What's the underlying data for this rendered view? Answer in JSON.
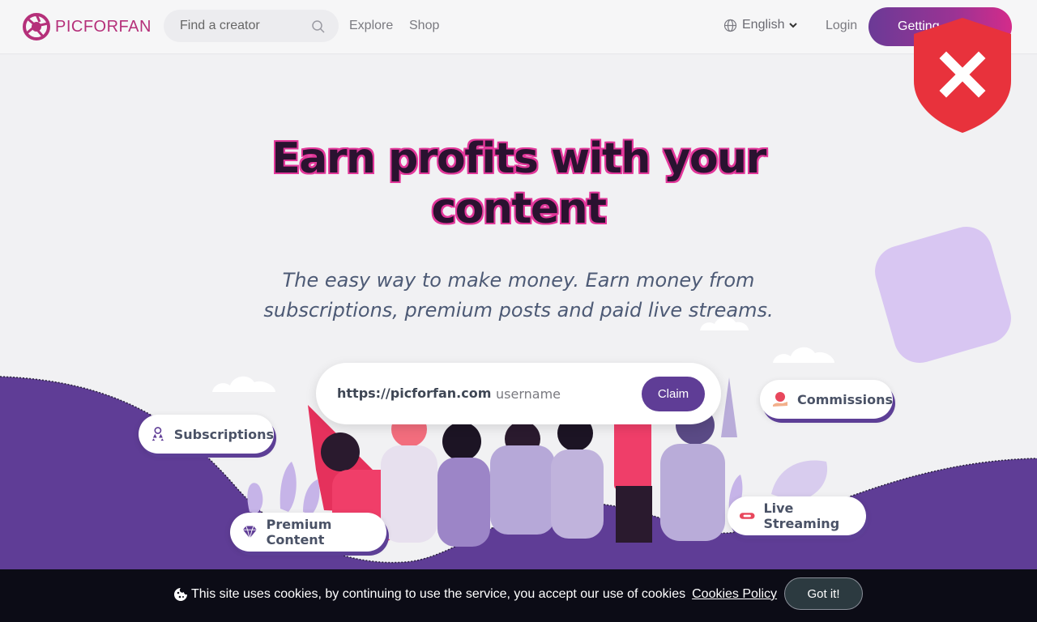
{
  "header": {
    "brand": "PICFORFAN",
    "search_placeholder": "Find a creator",
    "nav": {
      "explore": "Explore",
      "shop": "Shop"
    },
    "language": "English",
    "login": "Login",
    "cta": "Getting"
  },
  "hero": {
    "title_line1": "Earn profits with your",
    "title_line2": "content",
    "subtitle_line1": "The easy way to make money. Earn money from",
    "subtitle_line2": "subscriptions, premium posts and paid live streams."
  },
  "claim": {
    "url_prefix": "https://picforfan.com",
    "username_placeholder": "username",
    "button": "Claim"
  },
  "features": {
    "subscriptions": "Subscriptions",
    "commissions": "Commissions",
    "premium_content": "Premium Content",
    "live_streaming": "Live Streaming"
  },
  "cookie": {
    "message": "This site uses cookies, by continuing to use the service, you accept our use of cookies",
    "policy_link": "Cookies Policy",
    "button": "Got it!"
  },
  "colors": {
    "brand": "#b5307a",
    "primary": "#5f3d96",
    "title_outline": "#e2379a",
    "cookie_bg": "#0c0c16",
    "shield": "#e8323c"
  },
  "icons": {
    "logo": "camera-aperture-icon",
    "search": "search-icon",
    "language": "globe-icon",
    "language_caret": "chevron-down-icon",
    "shield": "shield-x-icon",
    "subscriptions": "users-stars-icon",
    "commissions": "coin-hand-icon",
    "premium_content": "diamond-icon",
    "live_streaming": "live-ticket-icon",
    "cookie": "cookie-icon"
  }
}
